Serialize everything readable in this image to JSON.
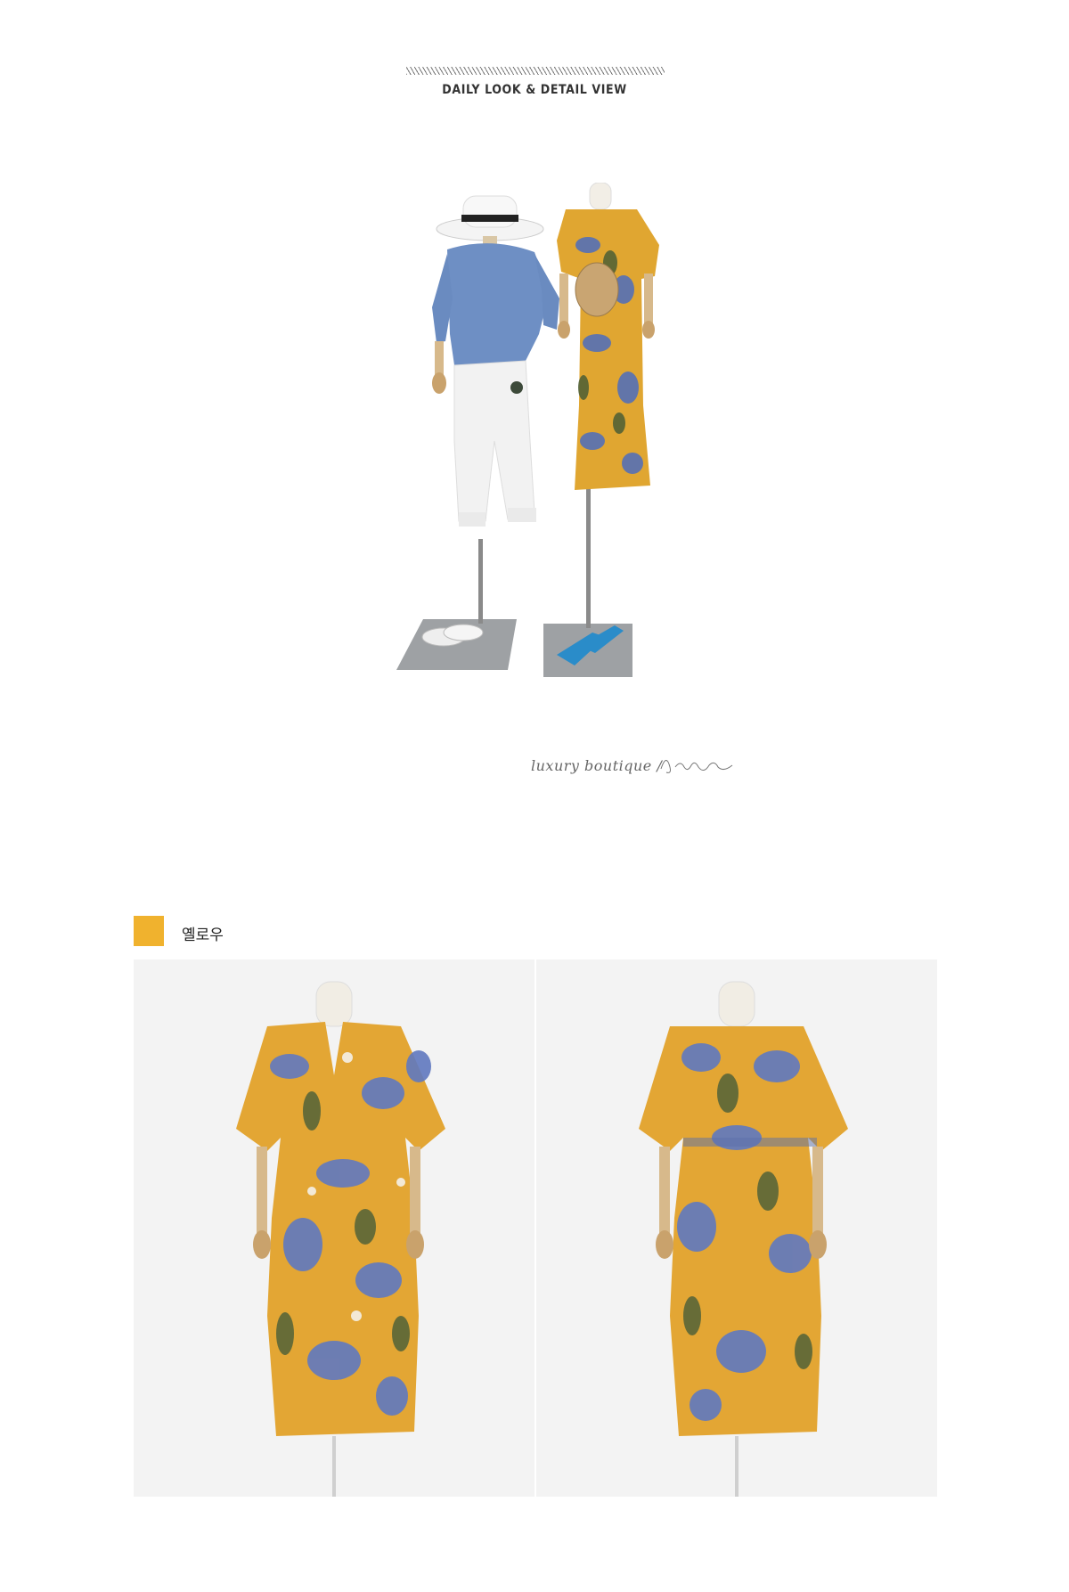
{
  "header": {
    "title": "DAILY LOOK & DETAIL VIEW"
  },
  "caption": {
    "text": "luxury boutique /",
    "signature": "J.blanc"
  },
  "color_option": {
    "name": "옐로우",
    "swatch_color": "#f0b22e"
  },
  "icons": [
    "hatch-divider",
    "mannequin-look-photo",
    "signature-mark",
    "dress-front-photo",
    "dress-back-photo"
  ]
}
